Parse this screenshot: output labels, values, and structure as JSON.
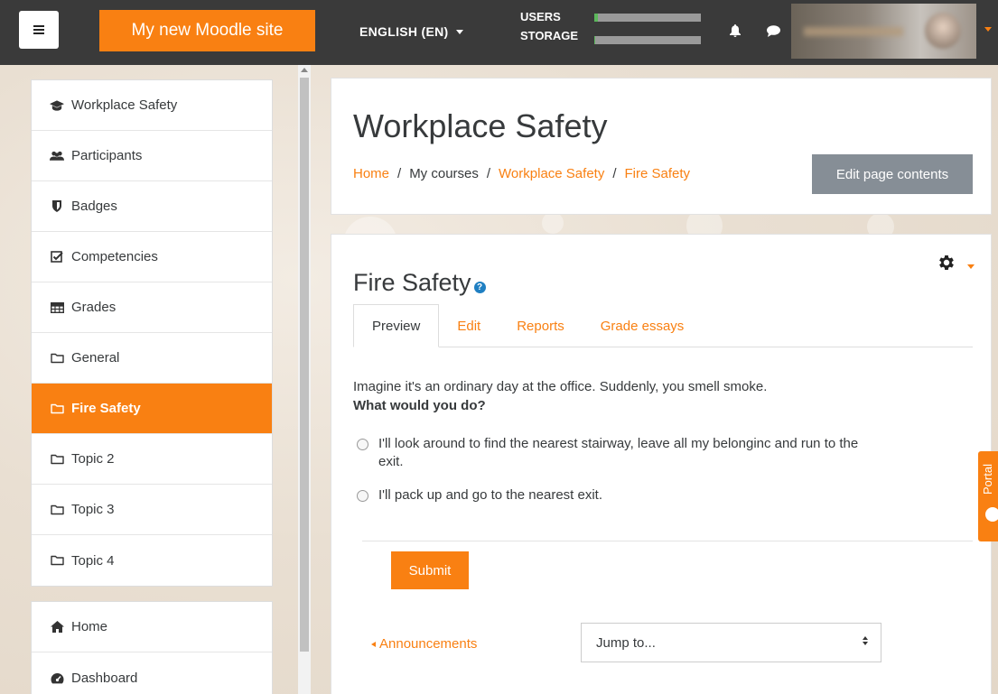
{
  "navbar": {
    "site_name": "My new Moodle site",
    "language": "ENGLISH (EN)",
    "quota": [
      {
        "label": "USERS",
        "fill_fraction": 0.03
      },
      {
        "label": "STORAGE",
        "fill_fraction": 0.01
      }
    ]
  },
  "sidebar": {
    "course_items": [
      {
        "label": "Workplace Safety",
        "icon": "graduation-cap-icon"
      },
      {
        "label": "Participants",
        "icon": "users-icon"
      },
      {
        "label": "Badges",
        "icon": "shield-icon"
      },
      {
        "label": "Competencies",
        "icon": "checkbox-icon"
      },
      {
        "label": "Grades",
        "icon": "table-icon"
      },
      {
        "label": "General",
        "icon": "folder-icon"
      },
      {
        "label": "Fire Safety",
        "icon": "folder-icon",
        "active": true
      },
      {
        "label": "Topic 2",
        "icon": "folder-icon"
      },
      {
        "label": "Topic 3",
        "icon": "folder-icon"
      },
      {
        "label": "Topic 4",
        "icon": "folder-icon"
      }
    ],
    "site_items": [
      {
        "label": "Home",
        "icon": "home-icon"
      },
      {
        "label": "Dashboard",
        "icon": "dashboard-icon"
      }
    ]
  },
  "header": {
    "title": "Workplace Safety",
    "breadcrumb": [
      "Home",
      "My courses",
      "Workplace Safety",
      "Fire Safety"
    ],
    "edit_button": "Edit page contents"
  },
  "lesson": {
    "title": "Fire Safety",
    "tabs": [
      "Preview",
      "Edit",
      "Reports",
      "Grade essays"
    ],
    "active_tab": "Preview",
    "intro": "Imagine it's an ordinary day at the office. Suddenly, you smell smoke.",
    "question": "What would you do?",
    "options": [
      "I'll look around to find the nearest stairway, leave all my belonginc and run to the exit.",
      "I'll pack up and go to the nearest exit."
    ],
    "submit_label": "Submit",
    "prev_activity": "Announcements",
    "jump_to": "Jump to..."
  },
  "portal_tab": "Portal",
  "colors": {
    "accent": "#f98012",
    "navbar": "#3a3a3a",
    "button_gray": "#868e96",
    "quota_fill": "#5cb85c"
  }
}
